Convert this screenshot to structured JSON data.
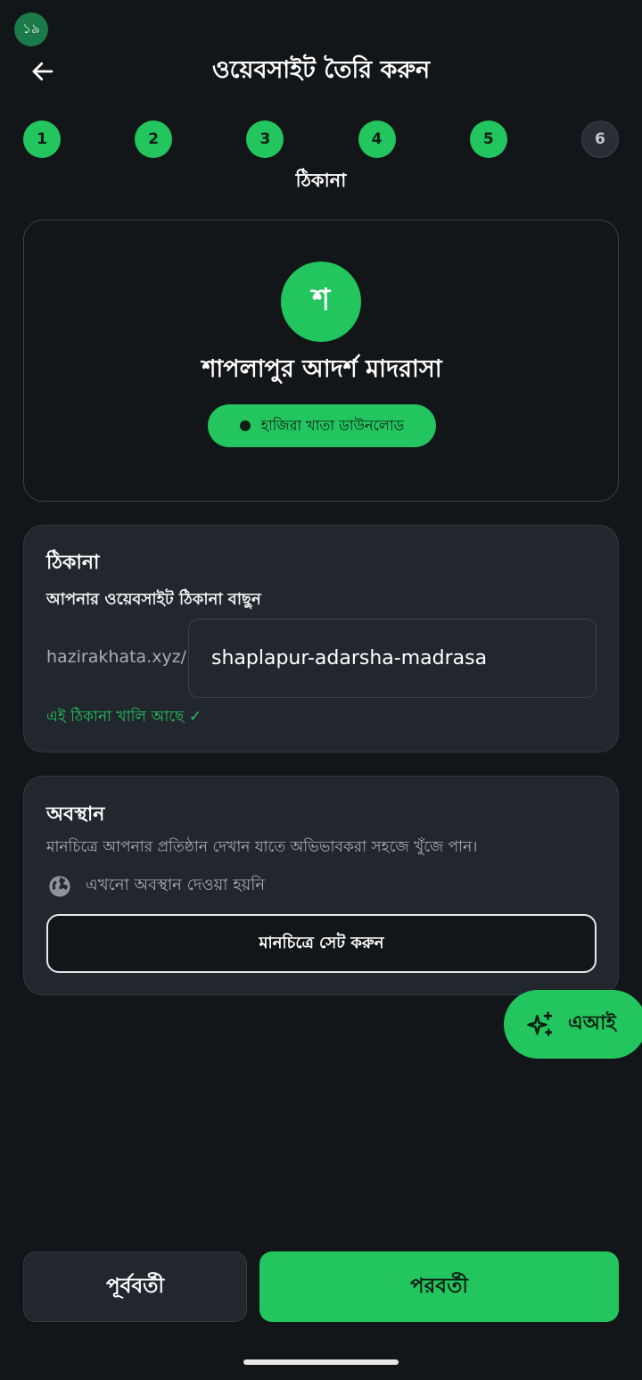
{
  "status_bar": {
    "badge_text": "১৯"
  },
  "header": {
    "back_icon": "arrow-left-icon",
    "title": "ওয়েবসাইট তৈরি করুন"
  },
  "stepper": {
    "steps": [
      {
        "label": "1",
        "state": "done"
      },
      {
        "label": "2",
        "state": "done"
      },
      {
        "label": "3",
        "state": "done"
      },
      {
        "label": "4",
        "state": "done"
      },
      {
        "label": "5",
        "state": "done"
      },
      {
        "label": "6",
        "state": "pending"
      }
    ],
    "current_step_label": "ঠিকানা"
  },
  "preview": {
    "avatar_letter": "শ",
    "site_name": "শাপলাপুর আদর্শ মাদরাসা",
    "tag": "হাজিরা খাতা ডাউনলোড"
  },
  "address": {
    "title": "ঠিকানা",
    "subtitle": "আপনার ওয়েবসাইট ঠিকানা বাছুন",
    "url_prefix": "hazirakhata.xyz/",
    "slug_value": "shaplapur-adarsha-madrasa",
    "availability": "এই ঠিকানা খালি আছে ✓"
  },
  "location": {
    "title": "অবস্থান",
    "description": "মানচিত্রে আপনার প্রতিষ্ঠান দেখান যাতে অভিভাবকরা সহজে খুঁজে পান।",
    "status": "এখনো অবস্থান দেওয়া হয়নি",
    "status_icon": "globe-icon",
    "set_button": "মানচিত্রে সেট করুন"
  },
  "ai_fab": {
    "label": "এআই",
    "icon": "sparkles-icon"
  },
  "footer": {
    "prev_label": "পূর্ববর্তী",
    "next_label": "পরবর্তী"
  },
  "colors": {
    "accent": "#22c55e",
    "background": "#131619",
    "card": "#22262d"
  }
}
